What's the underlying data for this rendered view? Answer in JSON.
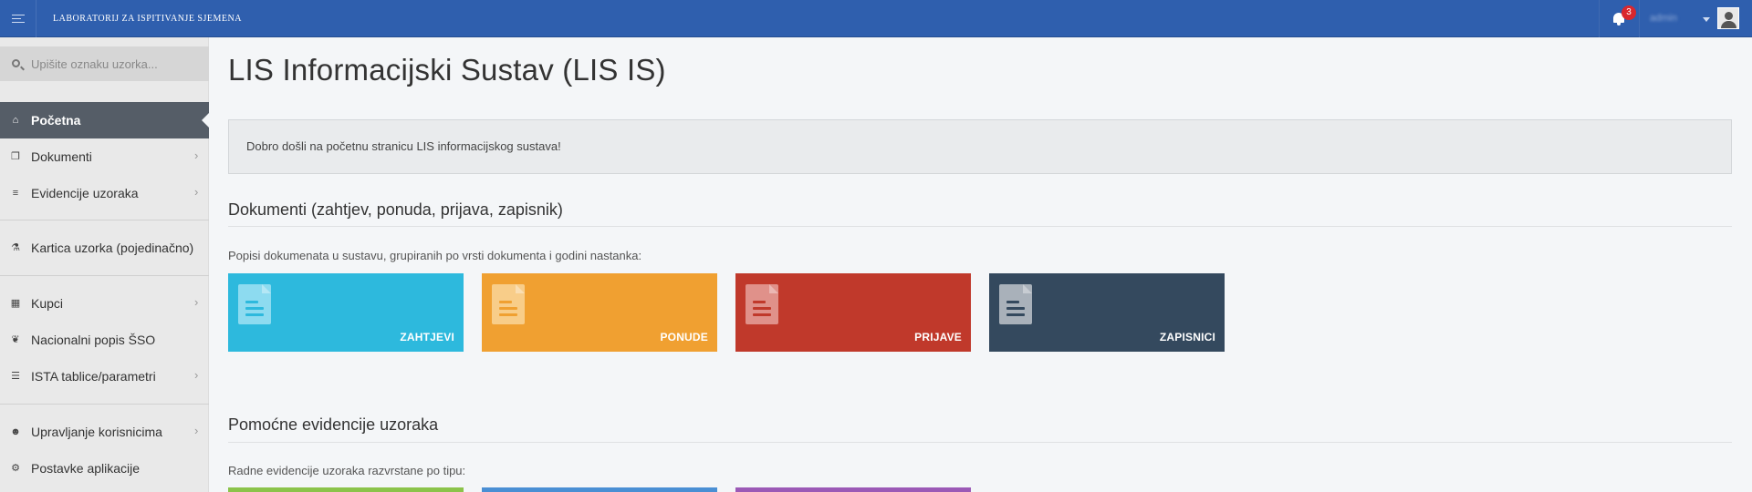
{
  "header": {
    "app_title": "LABORATORIJ ZA ISPITIVANJE SJEMENA",
    "notification_count": "3",
    "user_name": "admin"
  },
  "sidebar": {
    "search_placeholder": "Upišite oznaku uzorka...",
    "items": [
      {
        "label": "Početna",
        "icon": "home-icon"
      },
      {
        "label": "Dokumenti",
        "icon": "documents-icon"
      },
      {
        "label": "Evidencije uzoraka",
        "icon": "database-icon"
      },
      {
        "label": "Kartica uzorka (pojedinačno)",
        "icon": "flask-icon"
      },
      {
        "label": "Kupci",
        "icon": "table-icon"
      },
      {
        "label": "Nacionalni popis ŠSO",
        "icon": "leaf-icon"
      },
      {
        "label": "ISTA tablice/parametri",
        "icon": "list-icon"
      },
      {
        "label": "Upravljanje korisnicima",
        "icon": "users-icon"
      },
      {
        "label": "Postavke aplikacije",
        "icon": "cogs-icon"
      }
    ]
  },
  "main": {
    "page_title": "LIS Informacijski Sustav (LIS IS)",
    "welcome_text": "Dobro došli na početnu stranicu LIS informacijskog sustava!",
    "documents_section": {
      "title": "Dokumenti (zahtjev, ponuda, prijava, zapisnik)",
      "description": "Popisi dokumenata u sustavu, grupiranih po vrsti dokumenta i godini nastanka:",
      "tiles": [
        {
          "label": "ZAHTJEVI",
          "color": "#2db9dd",
          "icon_color": "#8ddbf0"
        },
        {
          "label": "PONUDE",
          "color": "#f0a031",
          "icon_color": "#f8cd89"
        },
        {
          "label": "PRIJAVE",
          "color": "#c0392b",
          "icon_color": "#e0918a"
        },
        {
          "label": "ZAPISNICI",
          "color": "#34495e",
          "icon_color": "#a9b1ba"
        }
      ]
    },
    "samples_section": {
      "title": "Pomoćne evidencije uzoraka",
      "description": "Radne evidencije uzoraka razvrstane po tipu:",
      "tile_colors": [
        "#8bc34a",
        "#4a8fd4",
        "#9b59b6"
      ]
    }
  }
}
